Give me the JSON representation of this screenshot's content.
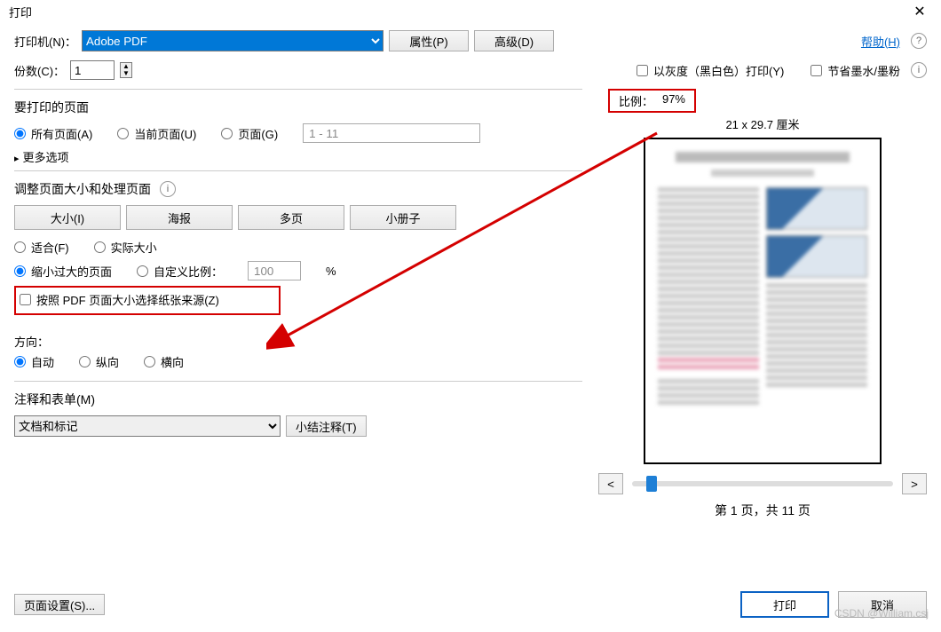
{
  "title": "打印",
  "printer": {
    "label": "打印机(N)：",
    "value": "Adobe PDF",
    "properties_btn": "属性(P)",
    "advanced_btn": "高级(D)"
  },
  "help_link": "帮助(H)",
  "copies": {
    "label": "份数(C)：",
    "value": "1"
  },
  "grayscale_label": "以灰度（黑白色）打印(Y)",
  "save_ink_label": "节省墨水/墨粉",
  "pages_section": {
    "title": "要打印的页面",
    "all": "所有页面(A)",
    "current": "当前页面(U)",
    "pages": "页面(G)",
    "range_value": "1 - 11",
    "more": "更多选项"
  },
  "size_section": {
    "title": "调整页面大小和处理页面",
    "tabs": {
      "size": "大小(I)",
      "poster": "海报",
      "multi": "多页",
      "booklet": "小册子"
    },
    "fit": "适合(F)",
    "actual": "实际大小",
    "shrink": "缩小过大的页面",
    "custom_scale": "自定义比例：",
    "custom_value": "100",
    "pdf_source": "按照 PDF 页面大小选择纸张来源(Z)"
  },
  "orientation": {
    "label": "方向：",
    "auto": "自动",
    "portrait": "纵向",
    "landscape": "横向"
  },
  "comments": {
    "title": "注释和表单(M)",
    "value": "文档和标记",
    "summary_btn": "小结注释(T)"
  },
  "scale": {
    "label": "比例：",
    "value": "97%"
  },
  "preview": {
    "dimensions": "21 x 29.7 厘米",
    "page_info": "第 1 页，共 11 页"
  },
  "footer": {
    "page_setup": "页面设置(S)...",
    "print": "打印",
    "cancel": "取消"
  },
  "watermark": "CSDN @William.csj"
}
